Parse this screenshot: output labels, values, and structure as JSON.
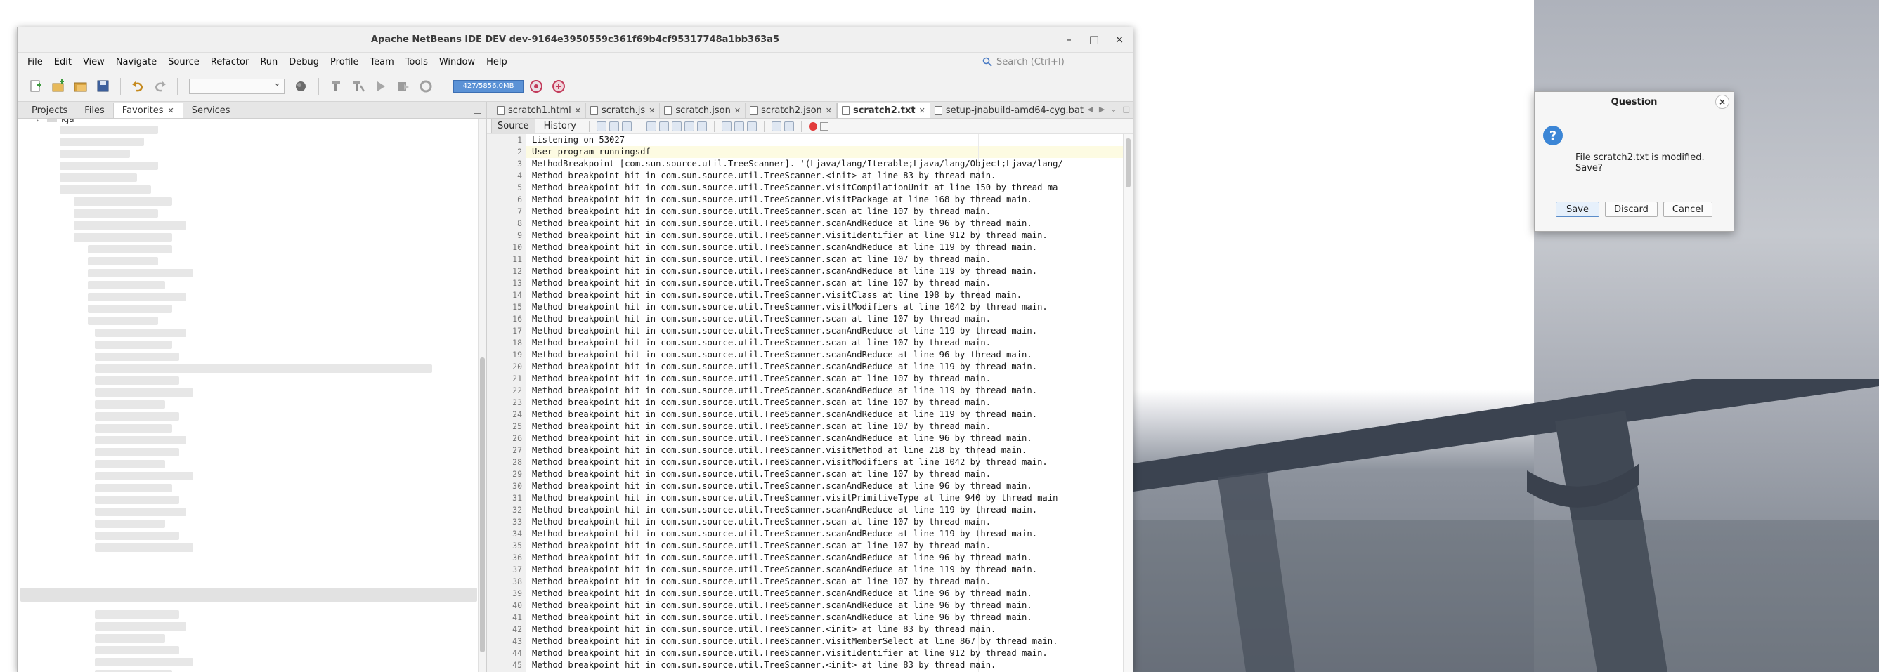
{
  "window": {
    "title": "Apache NetBeans IDE DEV dev-9164e3950559c361f69b4cf95317748a1bb363a5",
    "minimize_icon": "–",
    "maximize_icon": "□",
    "close_icon": "×"
  },
  "menu": [
    "File",
    "Edit",
    "View",
    "Navigate",
    "Source",
    "Refactor",
    "Run",
    "Debug",
    "Profile",
    "Team",
    "Tools",
    "Window",
    "Help"
  ],
  "search": {
    "placeholder": "Search (Ctrl+I)"
  },
  "toolbar": {
    "memory": "427/5856.0MB"
  },
  "left_panel": {
    "tabs": [
      {
        "label": "Projects",
        "closable": false
      },
      {
        "label": "Files",
        "closable": false
      },
      {
        "label": "Favorites",
        "closable": true
      },
      {
        "label": "Services",
        "closable": false
      }
    ],
    "active_tab": "Favorites",
    "first_item": "Kja"
  },
  "editor": {
    "tabs": [
      "scratch1.html",
      "scratch.js",
      "scratch.json",
      "scratch2.json",
      "scratch2.txt",
      "setup-jnabuild-amd64-cyg.bat"
    ],
    "active_tab": "scratch2.txt",
    "modes": [
      "Source",
      "History"
    ],
    "active_mode": "Source",
    "lines": [
      "Listening on 53027",
      "User program runningsdf",
      "MethodBreakpoint [com.sun.source.util.TreeScanner]. '(Ljava/lang/Iterable;Ljava/lang/Object;Ljava/lang/",
      "Method breakpoint hit in com.sun.source.util.TreeScanner.<init> at line 83 by thread main.",
      "Method breakpoint hit in com.sun.source.util.TreeScanner.visitCompilationUnit at line 150 by thread ma",
      "Method breakpoint hit in com.sun.source.util.TreeScanner.visitPackage at line 168 by thread main.",
      "Method breakpoint hit in com.sun.source.util.TreeScanner.scan at line 107 by thread main.",
      "Method breakpoint hit in com.sun.source.util.TreeScanner.scanAndReduce at line 96 by thread main.",
      "Method breakpoint hit in com.sun.source.util.TreeScanner.visitIdentifier at line 912 by thread main.",
      "Method breakpoint hit in com.sun.source.util.TreeScanner.scanAndReduce at line 119 by thread main.",
      "Method breakpoint hit in com.sun.source.util.TreeScanner.scan at line 107 by thread main.",
      "Method breakpoint hit in com.sun.source.util.TreeScanner.scanAndReduce at line 119 by thread main.",
      "Method breakpoint hit in com.sun.source.util.TreeScanner.scan at line 107 by thread main.",
      "Method breakpoint hit in com.sun.source.util.TreeScanner.visitClass at line 198 by thread main.",
      "Method breakpoint hit in com.sun.source.util.TreeScanner.visitModifiers at line 1042 by thread main.",
      "Method breakpoint hit in com.sun.source.util.TreeScanner.scan at line 107 by thread main.",
      "Method breakpoint hit in com.sun.source.util.TreeScanner.scanAndReduce at line 119 by thread main.",
      "Method breakpoint hit in com.sun.source.util.TreeScanner.scan at line 107 by thread main.",
      "Method breakpoint hit in com.sun.source.util.TreeScanner.scanAndReduce at line 96 by thread main.",
      "Method breakpoint hit in com.sun.source.util.TreeScanner.scanAndReduce at line 119 by thread main.",
      "Method breakpoint hit in com.sun.source.util.TreeScanner.scan at line 107 by thread main.",
      "Method breakpoint hit in com.sun.source.util.TreeScanner.scanAndReduce at line 119 by thread main.",
      "Method breakpoint hit in com.sun.source.util.TreeScanner.scan at line 107 by thread main.",
      "Method breakpoint hit in com.sun.source.util.TreeScanner.scanAndReduce at line 119 by thread main.",
      "Method breakpoint hit in com.sun.source.util.TreeScanner.scan at line 107 by thread main.",
      "Method breakpoint hit in com.sun.source.util.TreeScanner.scanAndReduce at line 96 by thread main.",
      "Method breakpoint hit in com.sun.source.util.TreeScanner.visitMethod at line 218 by thread main.",
      "Method breakpoint hit in com.sun.source.util.TreeScanner.visitModifiers at line 1042 by thread main.",
      "Method breakpoint hit in com.sun.source.util.TreeScanner.scan at line 107 by thread main.",
      "Method breakpoint hit in com.sun.source.util.TreeScanner.scanAndReduce at line 96 by thread main.",
      "Method breakpoint hit in com.sun.source.util.TreeScanner.visitPrimitiveType at line 940 by thread main",
      "Method breakpoint hit in com.sun.source.util.TreeScanner.scanAndReduce at line 119 by thread main.",
      "Method breakpoint hit in com.sun.source.util.TreeScanner.scan at line 107 by thread main.",
      "Method breakpoint hit in com.sun.source.util.TreeScanner.scanAndReduce at line 119 by thread main.",
      "Method breakpoint hit in com.sun.source.util.TreeScanner.scan at line 107 by thread main.",
      "Method breakpoint hit in com.sun.source.util.TreeScanner.scanAndReduce at line 96 by thread main.",
      "Method breakpoint hit in com.sun.source.util.TreeScanner.scanAndReduce at line 119 by thread main.",
      "Method breakpoint hit in com.sun.source.util.TreeScanner.scan at line 107 by thread main.",
      "Method breakpoint hit in com.sun.source.util.TreeScanner.scanAndReduce at line 96 by thread main.",
      "Method breakpoint hit in com.sun.source.util.TreeScanner.scanAndReduce at line 96 by thread main.",
      "Method breakpoint hit in com.sun.source.util.TreeScanner.scanAndReduce at line 96 by thread main.",
      "Method breakpoint hit in com.sun.source.util.TreeScanner.<init> at line 83 by thread main.",
      "Method breakpoint hit in com.sun.source.util.TreeScanner.visitMemberSelect at line 867 by thread main.",
      "Method breakpoint hit in com.sun.source.util.TreeScanner.visitIdentifier at line 912 by thread main.",
      "Method breakpoint hit in com.sun.source.util.TreeScanner.<init> at line 83 by thread main."
    ]
  },
  "dialog": {
    "title": "Question",
    "message": "File scratch2.txt is modified. Save?",
    "buttons": {
      "save": "Save",
      "discard": "Discard",
      "cancel": "Cancel"
    },
    "close_icon": "×",
    "question_icon": "?"
  }
}
